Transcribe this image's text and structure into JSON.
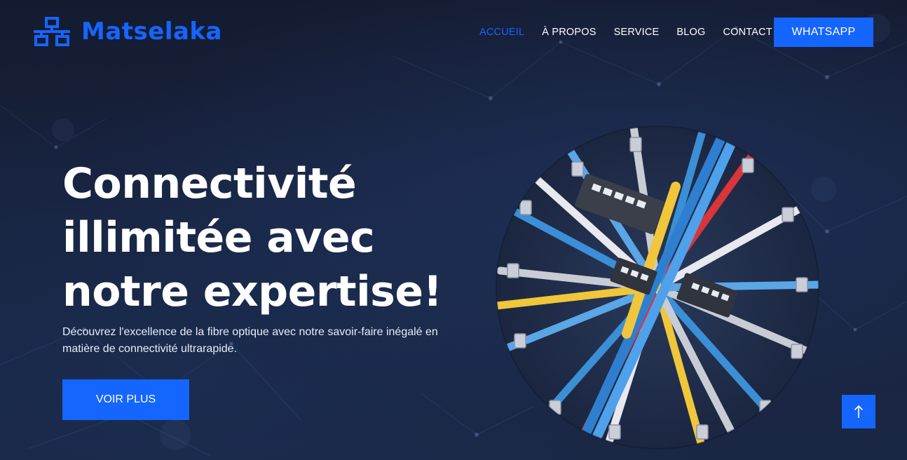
{
  "brand": {
    "name": "Matselaka",
    "logo_icon": "network-icon"
  },
  "nav": {
    "items": [
      {
        "label": "ACCUEIL",
        "active": true
      },
      {
        "label": "À PROPOS",
        "active": false
      },
      {
        "label": "SERVICE",
        "active": false
      },
      {
        "label": "BLOG",
        "active": false
      },
      {
        "label": "CONTACT",
        "active": false
      }
    ],
    "cta_label": "WHATSAPP"
  },
  "hero": {
    "title_lines": [
      "Connectivité",
      "illimitée avec",
      "notre expertise!"
    ],
    "description": "Découvrez l'excellence de la fibre optique avec notre savoir-faire inégalé en matière de connectivité ultrarapide.",
    "button_label": "VOIR PLUS",
    "image_icon": "network-cables-image"
  },
  "back_to_top": {
    "icon": "arrow-up-icon"
  },
  "colors": {
    "accent": "#1565ff",
    "background": "#16203a",
    "text": "#ffffff"
  }
}
